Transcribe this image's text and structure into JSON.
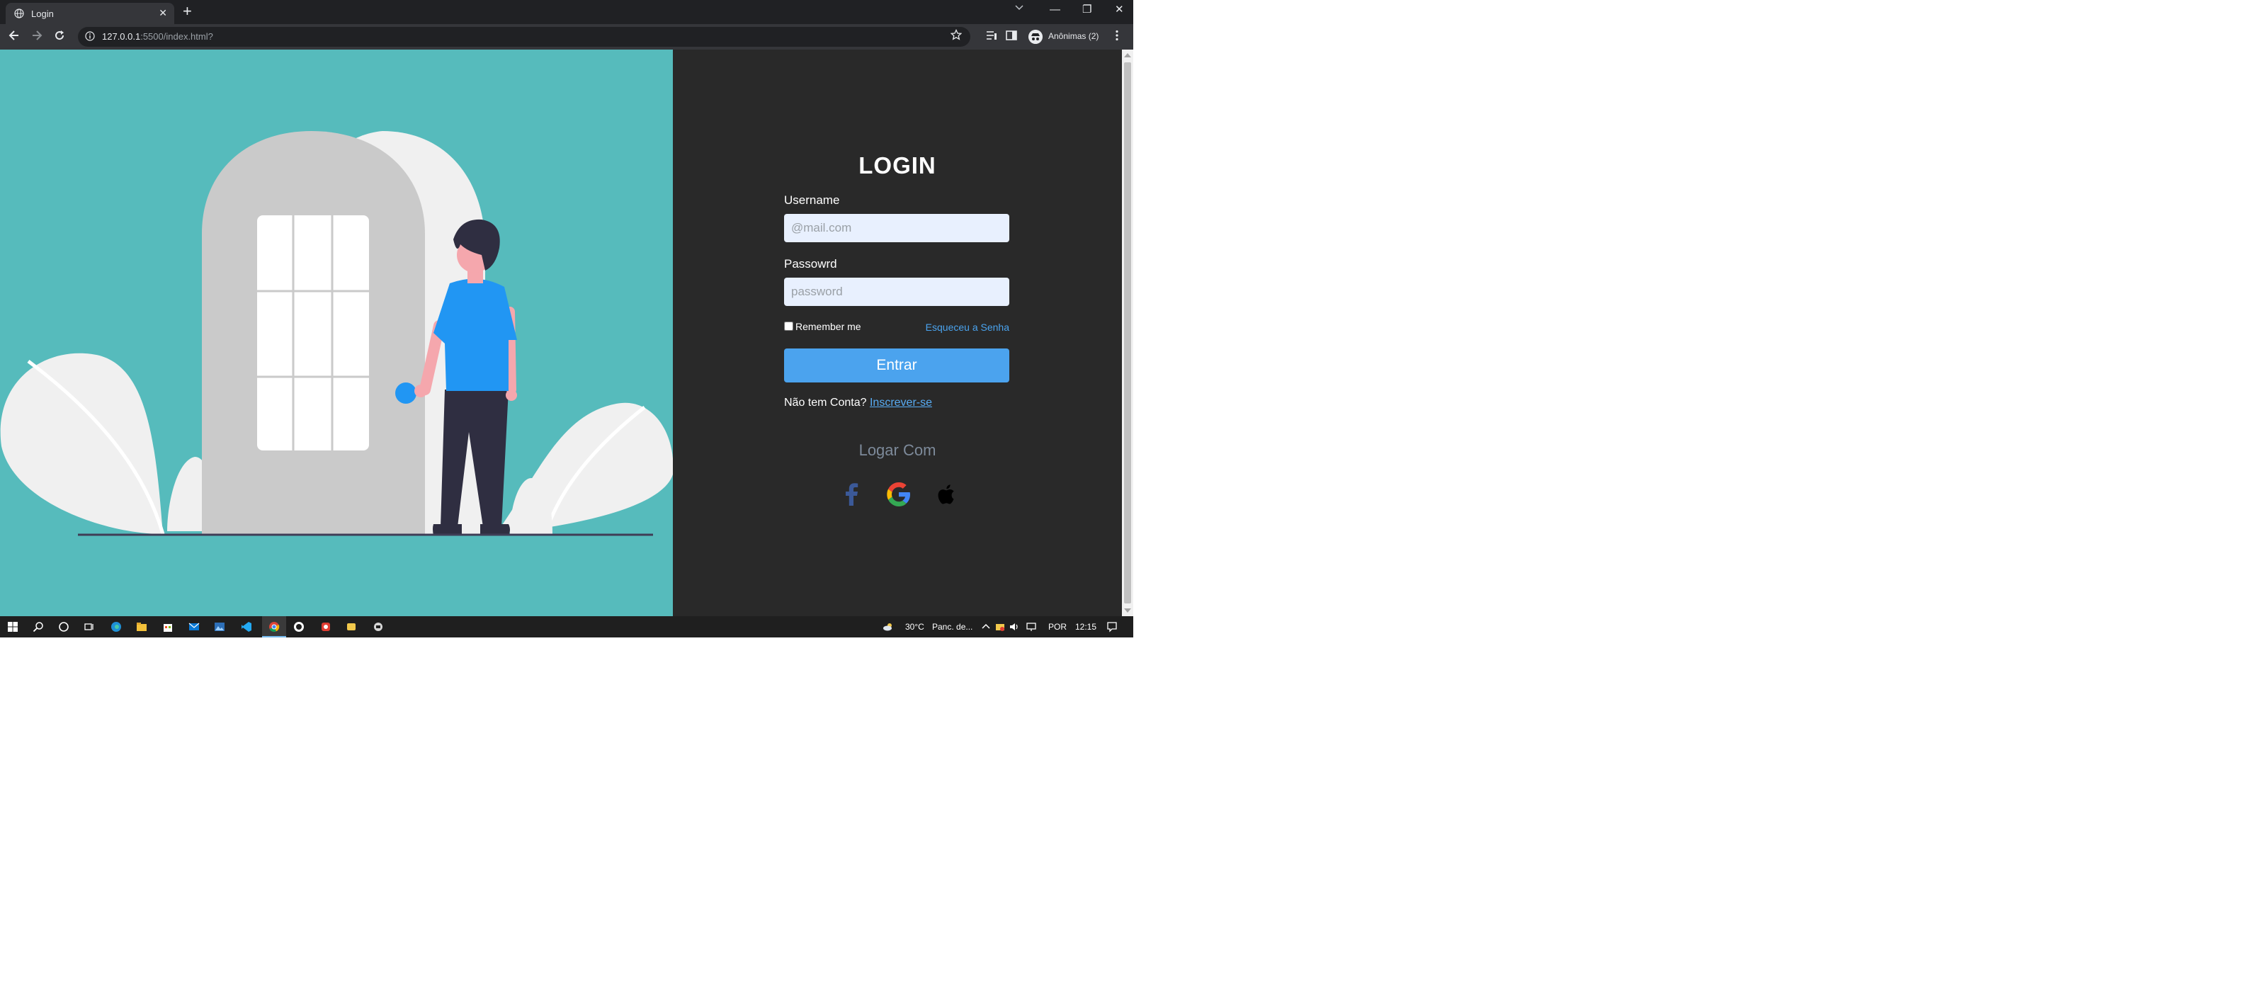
{
  "browser": {
    "tab_title": "Login",
    "tab_close": "✕",
    "new_tab": "+",
    "tab_search_icon": "chevron-down-icon",
    "url_host": "127.0.0.1",
    "url_path": ":5500/index.html?",
    "profile_label": "Anônimas (2)",
    "window_controls": {
      "minimize": "—",
      "restore": "❐",
      "close": "✕"
    }
  },
  "login": {
    "title": "LOGIN",
    "username_label": "Username",
    "username_placeholder": "@mail.com",
    "password_label": "Passowrd",
    "password_placeholder": "password",
    "remember_label": "Remember me",
    "forgot_link": "Esqueceu a Senha",
    "submit_label": "Entrar",
    "signup_prompt": "Não tem Conta?",
    "signup_link": "Inscrever-se",
    "social_heading": "Logar Com",
    "social": [
      "facebook-icon",
      "google-icon",
      "apple-icon"
    ]
  },
  "colors": {
    "illustration_bg": "#56bbbc",
    "panel_bg": "#292929",
    "primary_button": "#4ba3ee",
    "link": "#58acf4",
    "facebook": "#3b5998"
  },
  "taskbar": {
    "weather_temp": "30°C",
    "weather_text": "Panc. de...",
    "language": "POR",
    "time": "12:15"
  }
}
